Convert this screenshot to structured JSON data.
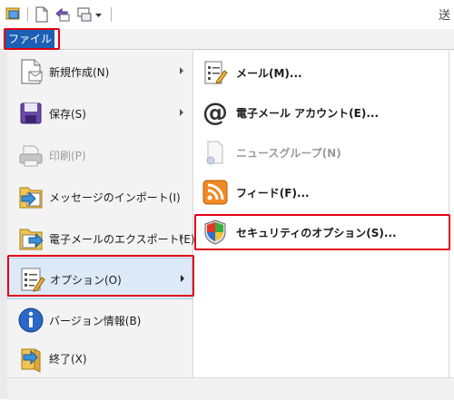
{
  "window": {
    "title_fragment": "送"
  },
  "ribbon": {
    "file_tab": "ファイル"
  },
  "menu": {
    "left_items": [
      {
        "label": "新規作成(N)",
        "icon": "new-document-icon",
        "submenu": true,
        "disabled": false
      },
      {
        "label": "保存(S)",
        "icon": "save-icon",
        "submenu": true,
        "disabled": false
      },
      {
        "label": "印刷(P)",
        "icon": "print-icon",
        "submenu": false,
        "disabled": true
      },
      {
        "label": "メッセージのインポート(I)",
        "icon": "import-icon",
        "submenu": false,
        "disabled": false
      },
      {
        "label": "電子メールのエクスポート(E)",
        "icon": "export-icon",
        "submenu": true,
        "disabled": false
      },
      {
        "label": "オプション(O)",
        "icon": "options-icon",
        "submenu": true,
        "disabled": false,
        "selected": true
      },
      {
        "label": "バージョン情報(B)",
        "icon": "info-icon",
        "submenu": false,
        "disabled": false
      },
      {
        "label": "終了(X)",
        "icon": "exit-icon",
        "submenu": false,
        "disabled": false
      }
    ],
    "right_items": [
      {
        "label": "メール(M)...",
        "icon": "mail-options-icon",
        "disabled": false
      },
      {
        "label": "電子メール アカウント(E)...",
        "icon": "at-sign-icon",
        "disabled": false
      },
      {
        "label": "ニュースグループ(N)",
        "icon": "newsgroup-icon",
        "disabled": true
      },
      {
        "label": "フィード(F)...",
        "icon": "rss-feed-icon",
        "disabled": false
      },
      {
        "label": "セキュリティのオプション(S)...",
        "icon": "security-shield-icon",
        "disabled": false
      }
    ]
  },
  "colors": {
    "file_tab_bg": "#1c5fb5",
    "highlight_border": "#e10012",
    "selected_bg": "#dceaf8"
  }
}
